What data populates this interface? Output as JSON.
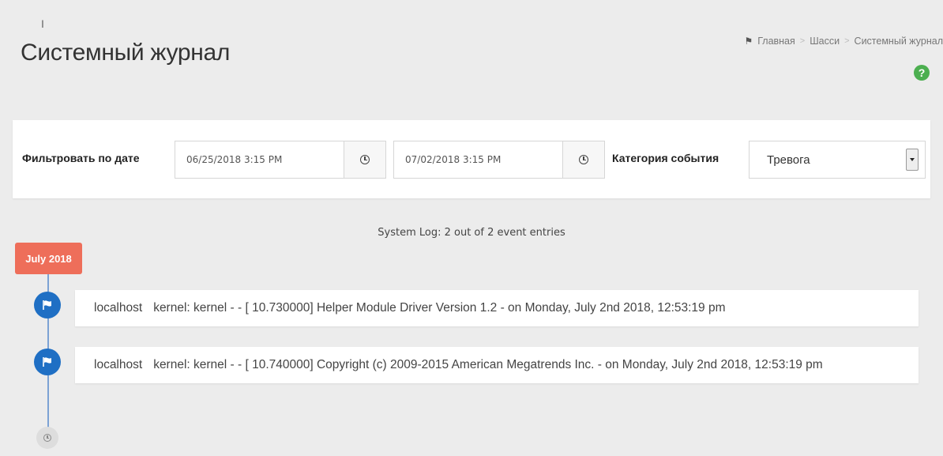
{
  "header": {
    "title": "Системный журнал",
    "breadcrumb": [
      "Главная",
      "Шасси",
      "Системный журнал"
    ]
  },
  "filter": {
    "date_label": "Фильтровать по дате",
    "date_from": "06/25/2018 3:15 PM",
    "date_separator": "-",
    "date_to": "07/02/2018 3:15 PM",
    "category_label": "Категория события",
    "category_value": "Тревога"
  },
  "log": {
    "summary": "System Log: 2 out of 2 event entries",
    "month": "July 2018",
    "entries": [
      {
        "host": "localhost",
        "message": "kernel: kernel - - [ 10.730000] Helper Module Driver Version 1.2 - on Monday, July 2nd 2018, 12:53:19 pm"
      },
      {
        "host": "localhost",
        "message": "kernel: kernel - - [ 10.740000] Copyright (c) 2009-2015 American Megatrends Inc. - on Monday, July 2nd 2018, 12:53:19 pm"
      }
    ]
  },
  "colors": {
    "accent": "#1f6fc4",
    "badge": "#ee6e5a",
    "help": "#4caf50"
  }
}
